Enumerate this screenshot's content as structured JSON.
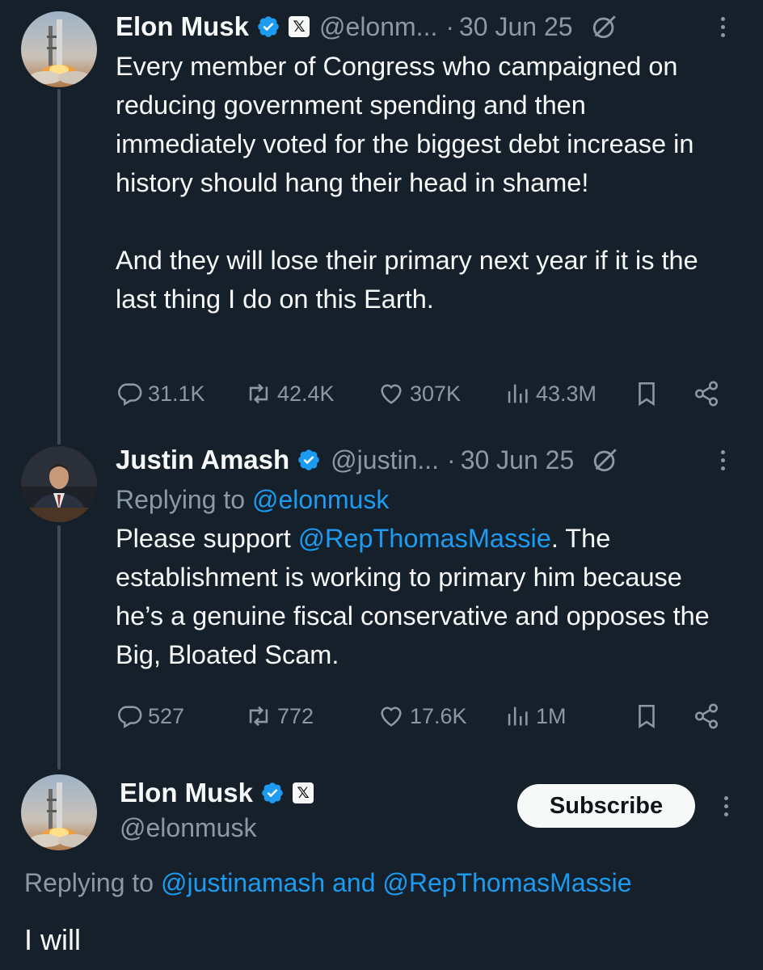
{
  "tweets": [
    {
      "name": "Elon Musk",
      "handle": "@elonm...",
      "dot": "·",
      "date": "30 Jun 25",
      "body": "Every member of Congress who campaigned on reducing government spending and then immediately voted for the biggest debt increase in history should hang their head in shame!\n\nAnd they will lose their primary next year if it is the last thing I do on this Earth.",
      "stats": {
        "replies": "31.1K",
        "reposts": "42.4K",
        "likes": "307K",
        "views": "43.3M"
      }
    },
    {
      "name": "Justin Amash",
      "handle": "@justin...",
      "dot": "·",
      "date": "30 Jun 25",
      "replying_prefix": "Replying to ",
      "replying_to": "@elonmusk",
      "body_pre": "Please support ",
      "body_mention": "@RepThomasMassie",
      "body_post": ". The establishment is working to primary him because he’s a genuine fiscal conservative and opposes the Big, Bloated Scam.",
      "stats": {
        "replies": "527",
        "reposts": "772",
        "likes": "17.6K",
        "views": "1M"
      }
    }
  ],
  "focused": {
    "name": "Elon Musk",
    "handle": "@elonmusk",
    "x_badge": "𝕏",
    "subscribe_label": "Subscribe",
    "replying_prefix": "Replying to ",
    "replying_to_1": "@justinamash",
    "replying_and": " and ",
    "replying_to_2": "@RepThomasMassie",
    "body": "I will"
  },
  "colors": {
    "background": "#15202b",
    "text": "#f7f9f9",
    "muted": "#8b98a5",
    "accent": "#1d9bf0",
    "verified": "#1d9bf0"
  },
  "icons": [
    "verified-badge-icon",
    "x-logo-icon",
    "grok-icon",
    "more-icon",
    "reply-icon",
    "repost-icon",
    "like-icon",
    "views-icon",
    "bookmark-icon",
    "share-icon"
  ]
}
